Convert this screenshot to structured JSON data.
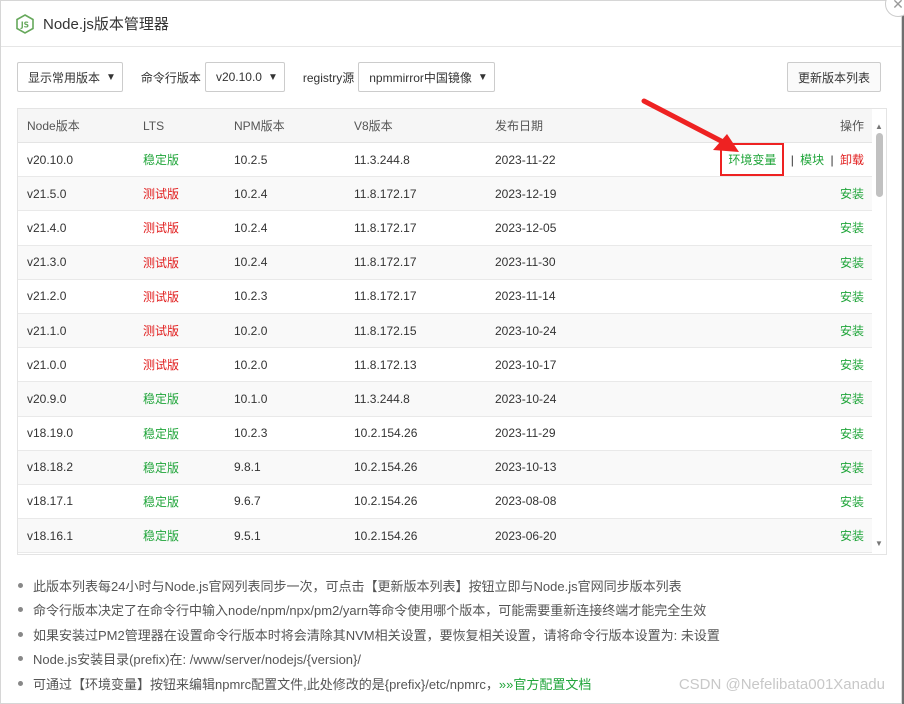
{
  "window": {
    "title": "Node.js版本管理器"
  },
  "toolbar": {
    "filter_select": "显示常用版本",
    "cli_label": "命令行版本",
    "cli_select": "v20.10.0",
    "registry_label": "registry源",
    "registry_select": "npmmirror中国镜像",
    "refresh_button": "更新版本列表"
  },
  "table": {
    "headers": [
      "Node版本",
      "LTS",
      "NPM版本",
      "V8版本",
      "发布日期",
      "操作"
    ],
    "current_row": {
      "version": "v20.10.0",
      "lts": "稳定版",
      "npm": "10.2.5",
      "v8": "11.3.244.8",
      "date": "2023-11-22",
      "ops": {
        "env": "环境变量",
        "sep1": "|",
        "module": "模块",
        "sep2": "|",
        "uninstall": "卸载"
      }
    },
    "rows": [
      {
        "version": "v21.5.0",
        "lts": "测试版",
        "npm": "10.2.4",
        "v8": "11.8.172.17",
        "date": "2023-12-19",
        "action": "安装"
      },
      {
        "version": "v21.4.0",
        "lts": "测试版",
        "npm": "10.2.4",
        "v8": "11.8.172.17",
        "date": "2023-12-05",
        "action": "安装"
      },
      {
        "version": "v21.3.0",
        "lts": "测试版",
        "npm": "10.2.4",
        "v8": "11.8.172.17",
        "date": "2023-11-30",
        "action": "安装"
      },
      {
        "version": "v21.2.0",
        "lts": "测试版",
        "npm": "10.2.3",
        "v8": "11.8.172.17",
        "date": "2023-11-14",
        "action": "安装"
      },
      {
        "version": "v21.1.0",
        "lts": "测试版",
        "npm": "10.2.0",
        "v8": "11.8.172.15",
        "date": "2023-10-24",
        "action": "安装"
      },
      {
        "version": "v21.0.0",
        "lts": "测试版",
        "npm": "10.2.0",
        "v8": "11.8.172.13",
        "date": "2023-10-17",
        "action": "安装"
      },
      {
        "version": "v20.9.0",
        "lts": "稳定版",
        "npm": "10.1.0",
        "v8": "11.3.244.8",
        "date": "2023-10-24",
        "action": "安装"
      },
      {
        "version": "v18.19.0",
        "lts": "稳定版",
        "npm": "10.2.3",
        "v8": "10.2.154.26",
        "date": "2023-11-29",
        "action": "安装"
      },
      {
        "version": "v18.18.2",
        "lts": "稳定版",
        "npm": "9.8.1",
        "v8": "10.2.154.26",
        "date": "2023-10-13",
        "action": "安装"
      },
      {
        "version": "v18.17.1",
        "lts": "稳定版",
        "npm": "9.6.7",
        "v8": "10.2.154.26",
        "date": "2023-08-08",
        "action": "安装"
      },
      {
        "version": "v18.16.1",
        "lts": "稳定版",
        "npm": "9.5.1",
        "v8": "10.2.154.26",
        "date": "2023-06-20",
        "action": "安装"
      }
    ]
  },
  "notes": [
    "此版本列表每24小时与Node.js官网列表同步一次，可点击【更新版本列表】按钮立即与Node.js官网同步版本列表",
    "命令行版本决定了在命令行中输入node/npm/npx/pm2/yarn等命令使用哪个版本，可能需要重新连接终端才能完全生效",
    "如果安装过PM2管理器在设置命令行版本时将会清除其NVM相关设置，要恢复相关设置，请将命令行版本设置为: 未设置",
    "Node.js安装目录(prefix)在: /www/server/nodejs/{version}/",
    "可通过【环境变量】按钮来编辑npmrc配置文件,此处修改的是{prefix}/etc/npmrc，"
  ],
  "doc_link": "»»官方配置文档",
  "watermark": "CSDN @Nefelibata001Xanadu",
  "colors": {
    "stable": "#20a53a",
    "test": "#e11d1d",
    "highlight_box": "#e22222"
  },
  "icons": [
    "nodejs-logo-icon",
    "close-icon",
    "caret-down-icon",
    "annotation-arrow-icon"
  ]
}
